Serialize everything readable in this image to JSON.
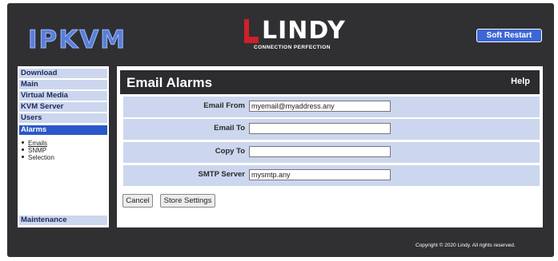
{
  "header": {
    "product_name": "IPKVM",
    "logo_text": "LINDY",
    "logo_tagline": "CONNECTION PERFECTION",
    "soft_restart_label": "Soft Restart"
  },
  "sidebar": {
    "items": [
      {
        "label": "Download"
      },
      {
        "label": "Main"
      },
      {
        "label": "Virtual Media"
      },
      {
        "label": "KVM Server"
      },
      {
        "label": "Users"
      },
      {
        "label": "Alarms"
      }
    ],
    "subitems": [
      {
        "label": "Emails"
      },
      {
        "label": "SNMP"
      },
      {
        "label": "Selection"
      }
    ],
    "maintenance_label": "Maintenance"
  },
  "main": {
    "title": "Email Alarms",
    "help_label": "Help",
    "fields": [
      {
        "label": "Email From",
        "value": "myemail@myaddress.any"
      },
      {
        "label": "Email To",
        "value": ""
      },
      {
        "label": "Copy To",
        "value": ""
      },
      {
        "label": "SMTP Server",
        "value": "mysmtp.any"
      }
    ],
    "cancel_label": "Cancel",
    "store_label": "Store Settings"
  },
  "footer": {
    "copyright": "Copyright © 2020 Lindy. All rights reserved."
  },
  "colors": {
    "frame": "#303033",
    "accent": "#2a57c9",
    "row_bg": "#ccd6ee",
    "logo_red": "#d01f2a"
  }
}
